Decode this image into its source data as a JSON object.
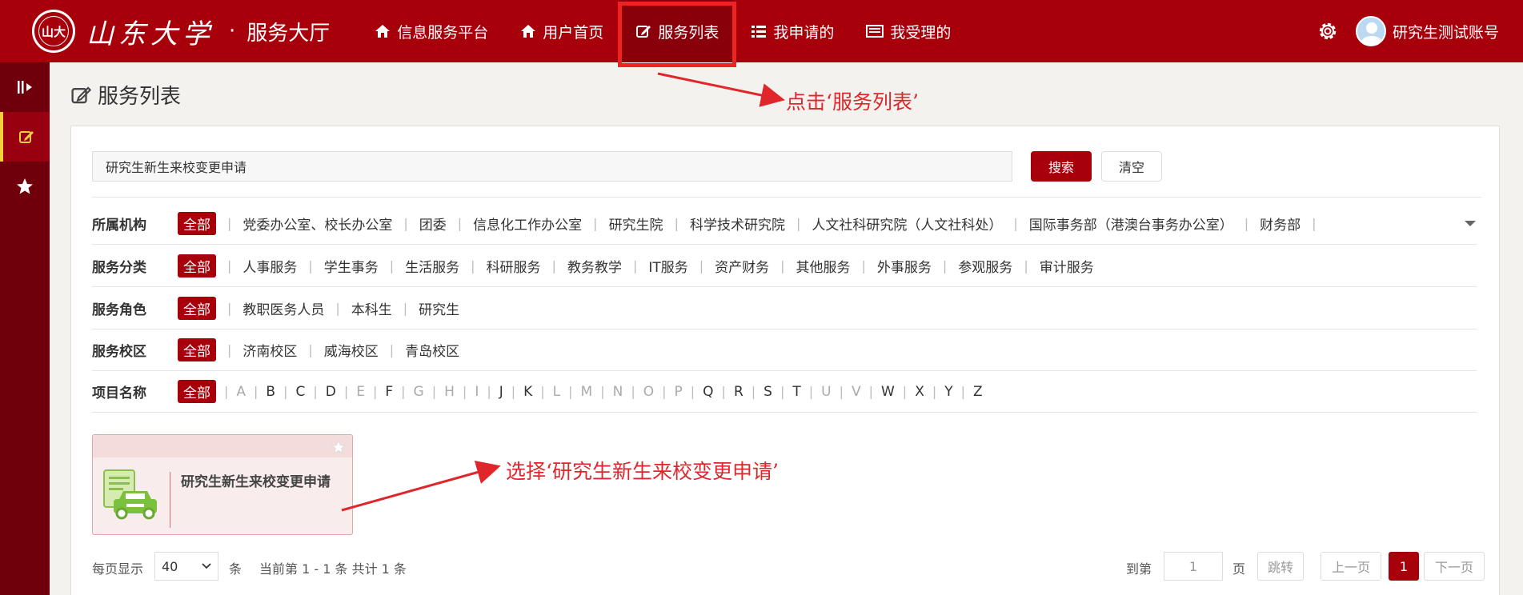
{
  "header": {
    "school_name": "山东大学",
    "seal_text": "山大",
    "separator": "·",
    "hall": "服务大厅",
    "nav": [
      {
        "label": "信息服务平台",
        "icon": "home-icon"
      },
      {
        "label": "用户首页",
        "icon": "home-icon"
      },
      {
        "label": "服务列表",
        "icon": "edit-icon",
        "active": true
      },
      {
        "label": "我申请的",
        "icon": "list-icon"
      },
      {
        "label": "我受理的",
        "icon": "inbox-icon"
      }
    ],
    "username": "研究生测试账号",
    "accent_color": "#a8000b"
  },
  "sidebar": {
    "items": [
      {
        "icon": "sidebar-toggle-icon"
      },
      {
        "icon": "edit-icon",
        "active": true
      },
      {
        "icon": "star-icon"
      }
    ]
  },
  "page": {
    "title": "服务列表"
  },
  "search": {
    "value": "研究生新生来校变更申请",
    "search_label": "搜索",
    "clear_label": "清空"
  },
  "filters": {
    "org": {
      "label": "所属机构",
      "options": [
        "全部",
        "党委办公室、校长办公室",
        "团委",
        "信息化工作办公室",
        "研究生院",
        "科学技术研究院",
        "人文社科研究院（人文社科处）",
        "国际事务部（港澳台事务办公室）",
        "财务部"
      ]
    },
    "category": {
      "label": "服务分类",
      "options": [
        "全部",
        "人事服务",
        "学生事务",
        "生活服务",
        "科研服务",
        "教务教学",
        "IT服务",
        "资产财务",
        "其他服务",
        "外事服务",
        "参观服务",
        "审计服务"
      ]
    },
    "role": {
      "label": "服务角色",
      "options": [
        "全部",
        "教职医务人员",
        "本科生",
        "研究生"
      ]
    },
    "campus": {
      "label": "服务校区",
      "options": [
        "全部",
        "济南校区",
        "威海校区",
        "青岛校区"
      ]
    },
    "name": {
      "label": "项目名称",
      "all": "全部",
      "letters": [
        "A",
        "B",
        "C",
        "D",
        "E",
        "F",
        "G",
        "H",
        "I",
        "J",
        "K",
        "L",
        "M",
        "N",
        "O",
        "P",
        "Q",
        "R",
        "S",
        "T",
        "U",
        "V",
        "W",
        "X",
        "Y",
        "Z"
      ],
      "disabled": [
        "A",
        "E",
        "G",
        "H",
        "I",
        "L",
        "M",
        "N",
        "O",
        "P",
        "U",
        "V"
      ]
    }
  },
  "card": {
    "title": "研究生新生来校变更申请"
  },
  "pagination": {
    "per_page_label": "每页显示",
    "per_page_value": "40",
    "unit": "条",
    "summary": "当前第 1 - 1 条 共计 1 条",
    "goto_label": "到第",
    "goto_value": "1",
    "page_unit": "页",
    "jump_label": "跳转",
    "prev_label": "上一页",
    "current_page": "1",
    "next_label": "下一页"
  },
  "annotations": {
    "click_tip": "点击‘服务列表’",
    "select_tip": "选择‘研究生新生来校变更申请’"
  }
}
